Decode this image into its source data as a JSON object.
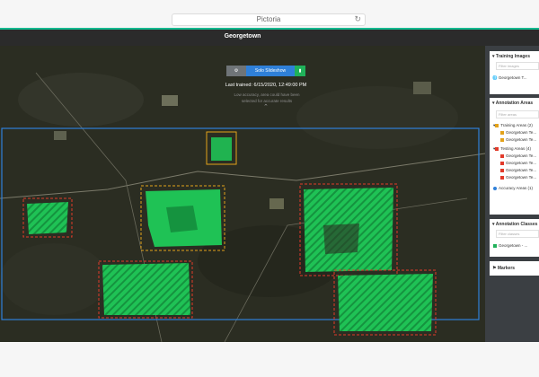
{
  "browser": {
    "tab_title": "Pictoria",
    "reload_icon": "reload-icon"
  },
  "app": {
    "project_name": "Georgetown",
    "accent": "#14b98f"
  },
  "controls": {
    "settings_icon": "gear-icon",
    "slideshow_label": "Solo Slideshow",
    "document_icon": "document-icon",
    "last_trained": "Last trained: 6/15/2020, 12:49:00 PM",
    "hint": "Low accuracy, area could have been selected for accurate results",
    "collapse_icon": "chevron-up-icon"
  },
  "sidebar": {
    "training_images": {
      "header": "Training Images",
      "filter_placeholder": "Filter images",
      "items": [
        {
          "icon": "globe-icon",
          "label": "Georgetown T..."
        }
      ]
    },
    "annotation_areas": {
      "header": "Annotation Areas",
      "filter_placeholder": "Filter areas",
      "training_group": "Training Areas (2)",
      "training_items": [
        "Georgetown Te...",
        "Georgetown Te..."
      ],
      "testing_group": "Testing Areas (4)",
      "testing_items": [
        "Georgetown Te...",
        "Georgetown Te...",
        "Georgetown Te...",
        "Georgetown Te..."
      ],
      "accuracy_label": "Accuracy Areas (1)"
    },
    "annotation_classes": {
      "header": "Annotation Classes",
      "filter_placeholder": "Filter classes",
      "items": [
        {
          "label": "Georgetown - ...",
          "color": "#20b15a"
        }
      ]
    },
    "markers": {
      "icon": "flag-icon",
      "label": "Markers"
    }
  },
  "colors": {
    "training_area": "#e3a21a",
    "testing_area": "#e23a2a",
    "accuracy_area": "#2f80d9",
    "class_fill": "#1fc255"
  }
}
